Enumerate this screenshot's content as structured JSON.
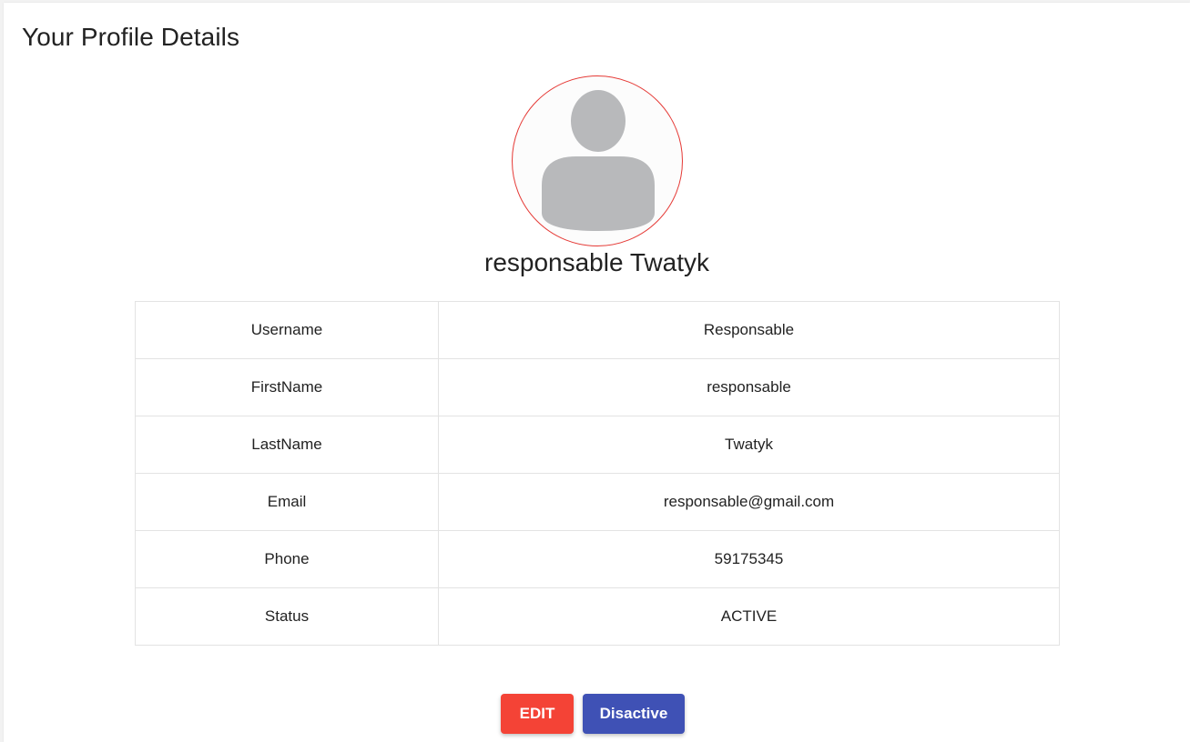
{
  "page": {
    "title": "Your Profile Details"
  },
  "profile": {
    "avatar_icon": "user-silhouette-icon",
    "first_name": "responsable",
    "last_name": "Twatyk",
    "rows": [
      {
        "label": "Username",
        "value": "Responsable"
      },
      {
        "label": "FirstName",
        "value": "responsable"
      },
      {
        "label": "LastName",
        "value": "Twatyk"
      },
      {
        "label": "Email",
        "value": "responsable@gmail.com"
      },
      {
        "label": "Phone",
        "value": "59175345"
      },
      {
        "label": "Status",
        "value": "ACTIVE"
      }
    ]
  },
  "actions": {
    "edit_label": "EDIT",
    "disactive_label": "Disactive"
  },
  "colors": {
    "edit_button": "#f44336",
    "disactive_button": "#3f51b5",
    "avatar_border": "#e53935",
    "avatar_silhouette": "#b8b9bb"
  }
}
